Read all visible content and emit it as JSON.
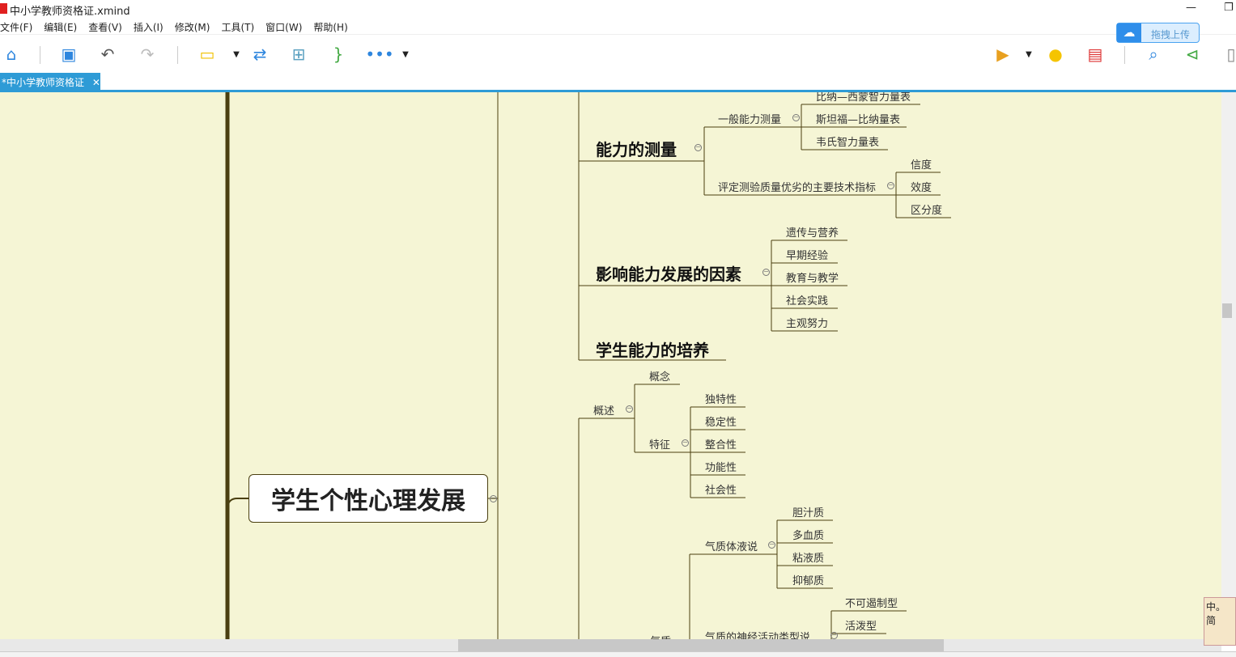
{
  "window": {
    "title": "中小学教师资格证.xmind",
    "minimize": "—",
    "restore": "❐"
  },
  "menu": [
    "文件(F)",
    "编辑(E)",
    "查看(V)",
    "插入(I)",
    "修改(M)",
    "工具(T)",
    "窗口(W)",
    "帮助(H)"
  ],
  "upload": {
    "icon": "☁",
    "label": "拖拽上传"
  },
  "tab": {
    "label": "*中小学教师资格证",
    "close": "✕"
  },
  "mindmap": {
    "root": "学生个性心理发展",
    "n1": "能力的测量",
    "n1a": "一般能力测量",
    "n1a1": "比纳—西蒙智力量表",
    "n1a2": "斯坦福—比纳量表",
    "n1a3": "韦氏智力量表",
    "n1b": "评定测验质量优劣的主要技术指标",
    "n1b1": "信度",
    "n1b2": "效度",
    "n1b3": "区分度",
    "n2": "影响能力发展的因素",
    "n2a": "遗传与营养",
    "n2b": "早期经验",
    "n2c": "教育与教学",
    "n2d": "社会实践",
    "n2e": "主观努力",
    "n3": "学生能力的培养",
    "g1": "概述",
    "g1a": "概念",
    "g1b": "特征",
    "g1b1": "独特性",
    "g1b2": "稳定性",
    "g1b3": "整合性",
    "g1b4": "功能性",
    "g1b5": "社会性",
    "g2": "气质",
    "g2a": "气质体液说",
    "g2a1": "胆汁质",
    "g2a2": "多血质",
    "g2a3": "粘液质",
    "g2a4": "抑郁质",
    "g2b": "气质的神经活动类型说",
    "g2b1": "不可遏制型",
    "g2b2": "活泼型"
  },
  "mascot": "中。简"
}
